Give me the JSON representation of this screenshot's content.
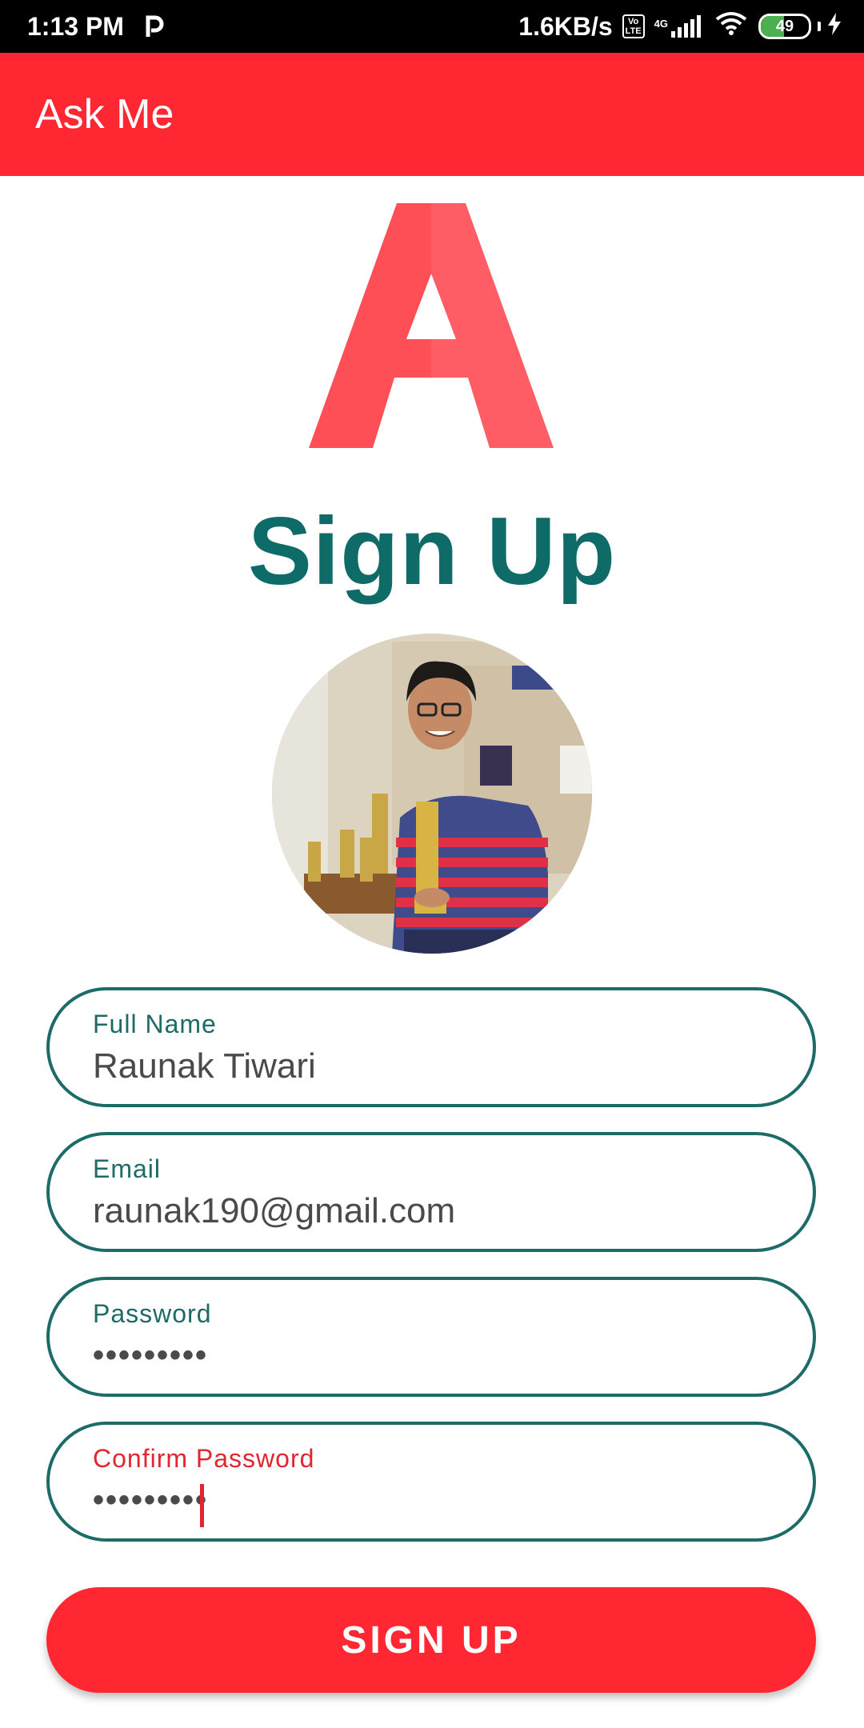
{
  "status_bar": {
    "time": "1:13 PM",
    "network_speed": "1.6KB/s",
    "volte_top": "Vo",
    "volte_bottom": "LTE",
    "network_type": "4G",
    "battery_level": "49",
    "battery_fraction": 0.49,
    "charging": true
  },
  "app_bar": {
    "title": "Ask Me",
    "background": "#ff2731"
  },
  "page": {
    "title": "Sign Up",
    "title_color": "#0f6b68"
  },
  "form": {
    "full_name": {
      "label": "Full Name",
      "value": "Raunak Tiwari"
    },
    "email": {
      "label": "Email",
      "value": "raunak190@gmail.com"
    },
    "password": {
      "label": "Password",
      "value": "•••••••••"
    },
    "confirm_password": {
      "label": "Confirm Password",
      "value": "•••••••••"
    }
  },
  "submit": {
    "label": "SIGN UP"
  },
  "icons": [
    "logo-a-icon",
    "p-app-icon",
    "signal-icon",
    "wifi-icon",
    "battery-icon",
    "charging-bolt-icon"
  ]
}
